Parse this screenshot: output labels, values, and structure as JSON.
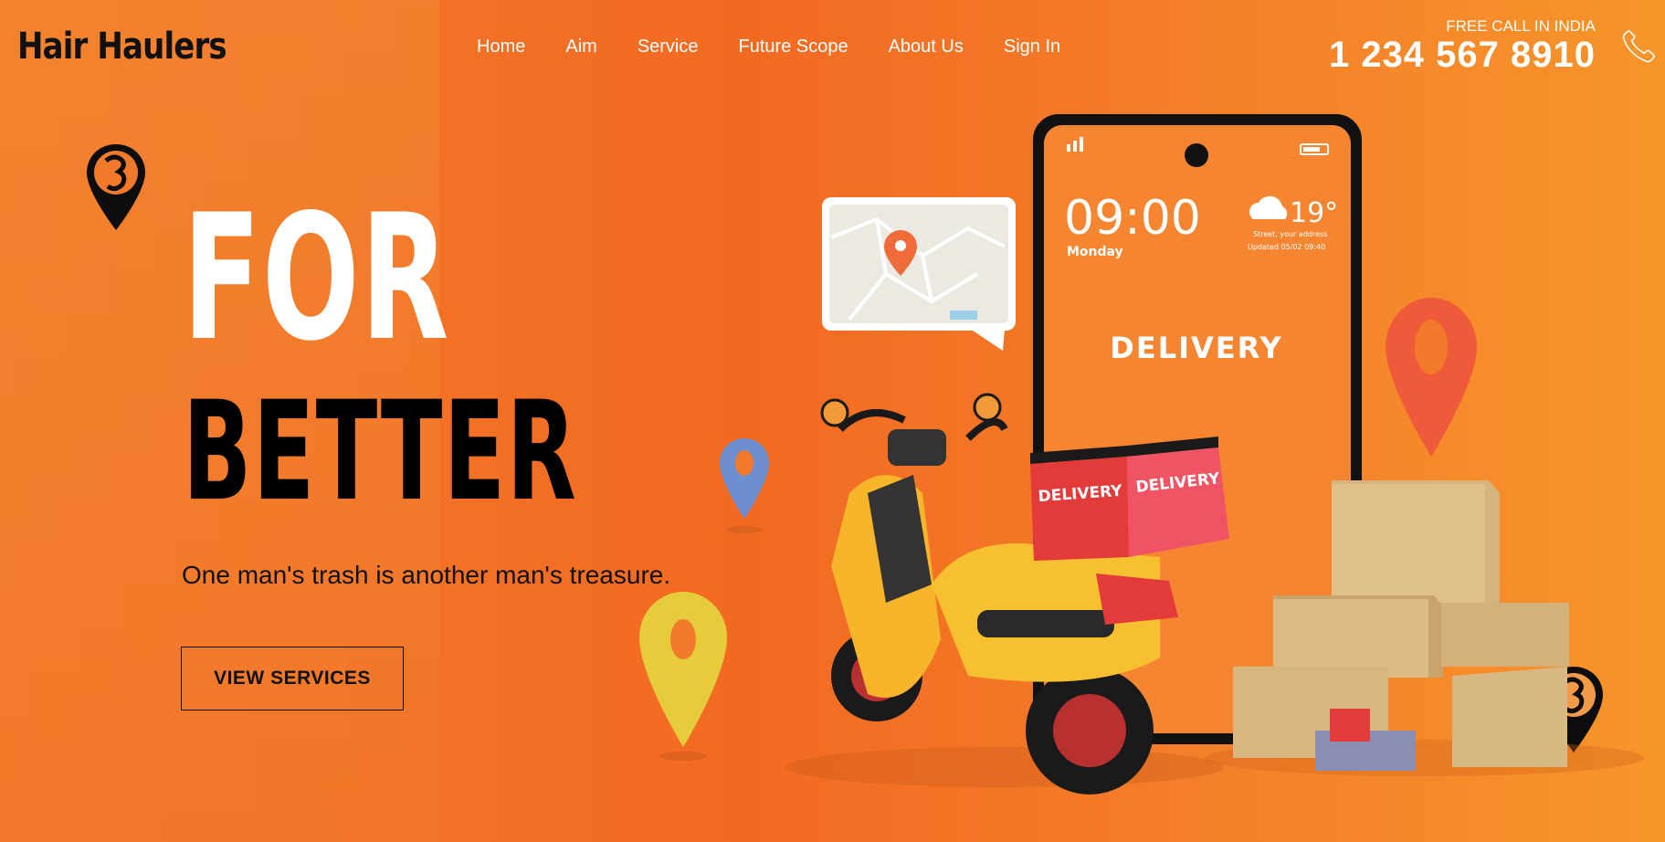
{
  "header": {
    "logo": "Hair Haulers",
    "nav": [
      "Home",
      "Aim",
      "Service",
      "Future Scope",
      "About Us",
      "Sign In"
    ],
    "call_label": "FREE CALL IN INDIA",
    "call_number": "1 234 567 8910",
    "phone_icon": "phone-icon"
  },
  "hero": {
    "line1": "FOR",
    "line2": "BETTER",
    "tagline": "One man's trash is another man's treasure.",
    "button": "VIEW SERVICES"
  },
  "illustration": {
    "phone_time": "09:00",
    "phone_day": "Monday",
    "phone_temp": "19°",
    "phone_address": "Street, your address",
    "phone_updated": "Updated 05/02 09:40",
    "phone_label": "DELIVERY",
    "box_label": "DELIVERY"
  },
  "colors": {
    "accent": "#f47a2a",
    "dark": "#111111",
    "light": "#ffffff"
  }
}
